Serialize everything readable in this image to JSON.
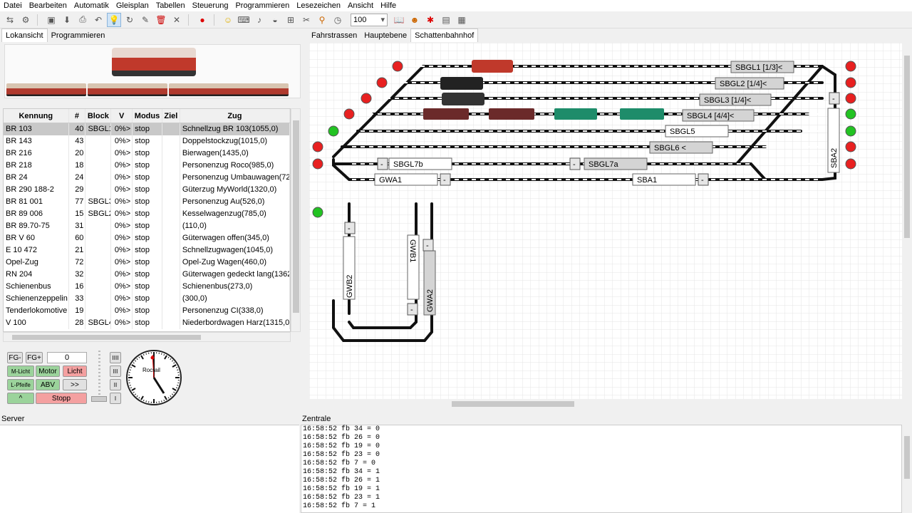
{
  "menu": [
    "Datei",
    "Bearbeiten",
    "Automatik",
    "Gleisplan",
    "Tabellen",
    "Steuerung",
    "Programmieren",
    "Lesezeichen",
    "Ansicht",
    "Hilfe"
  ],
  "toolbar": {
    "zoom": "100"
  },
  "left_tabs": [
    "Lokansicht",
    "Programmieren"
  ],
  "right_tabs": [
    "Fahrstrassen",
    "Hauptebene",
    "Schattenbahnhof"
  ],
  "table": {
    "headers": [
      "Kennung",
      "#",
      "Block",
      "V",
      "Modus",
      "Ziel",
      "Zug"
    ],
    "rows": [
      [
        "BR 103",
        "40",
        "SBGL1",
        "0%>",
        "stop",
        "",
        "Schnellzug BR 103(1055,0)"
      ],
      [
        "BR 143",
        "43",
        "",
        "0%>",
        "stop",
        "",
        "Doppelstockzug(1015,0)"
      ],
      [
        "BR 216",
        "20",
        "",
        "0%>",
        "stop",
        "",
        "Bierwagen(1435,0)"
      ],
      [
        "BR 218",
        "18",
        "",
        "0%>",
        "stop",
        "",
        "Personenzug Roco(985,0)"
      ],
      [
        "BR 24",
        "24",
        "",
        "0%>",
        "stop",
        "",
        "Personenzug Umbauwagen(725,0"
      ],
      [
        "BR 290 188-2",
        "29",
        "",
        "0%>",
        "stop",
        "",
        "Güterzug MyWorld(1320,0)"
      ],
      [
        "BR 81 001",
        "77",
        "SBGL3",
        "0%>",
        "stop",
        "",
        "Personenzug Au(526,0)"
      ],
      [
        "BR 89 006",
        "15",
        "SBGL2",
        "0%>",
        "stop",
        "",
        "Kesselwagenzug(785,0)"
      ],
      [
        "BR 89.70-75",
        "31",
        "",
        "0%>",
        "stop",
        "",
        "(110,0)"
      ],
      [
        "BR V 60",
        "60",
        "",
        "0%>",
        "stop",
        "",
        "Güterwagen offen(345,0)"
      ],
      [
        "E 10 472",
        "21",
        "",
        "0%>",
        "stop",
        "",
        "Schnellzugwagen(1045,0)"
      ],
      [
        "Opel-Zug",
        "72",
        "",
        "0%>",
        "stop",
        "",
        "Opel-Zug Wagen(460,0)"
      ],
      [
        "RN 204",
        "32",
        "",
        "0%>",
        "stop",
        "",
        "Güterwagen gedeckt lang(1362,0"
      ],
      [
        "Schienenbus",
        "16",
        "",
        "0%>",
        "stop",
        "",
        "Schienenbus(273,0)"
      ],
      [
        "Schienenzeppelin",
        "33",
        "",
        "0%>",
        "stop",
        "",
        "(300,0)"
      ],
      [
        "Tenderlokomotive",
        "19",
        "",
        "0%>",
        "stop",
        "",
        "Personenzug CI(338,0)"
      ],
      [
        "V 100",
        "28",
        "SBGL4",
        "0%>",
        "stop",
        "",
        "Niederbordwagen Harz(1315,0)"
      ]
    ]
  },
  "controls": {
    "fg_minus": "FG-",
    "fg_plus": "FG+",
    "speed": "0",
    "m_licht": "M-Licht",
    "motor": "Motor",
    "licht": "Licht",
    "l_pfeife": "L-Pfeife",
    "abv": "ABV",
    "fwd": ">>",
    "up": "^",
    "stopp": "Stopp",
    "dir_btns": [
      "IIII",
      "III",
      "II",
      "I"
    ],
    "clock_label": "Rocrail"
  },
  "blocks": {
    "sbgl1": "SBGL1 [1/3]<",
    "sbgl2": "SBGL2 [1/4]<",
    "sbgl3": "SBGL3 [1/4]<",
    "sbgl4": "SBGL4 [4/4]<",
    "sbgl5": "SBGL5",
    "sbgl6": "SBGL6 <",
    "sbgl7b": "SBGL7b",
    "sbgl7a": "SBGL7a",
    "gwa1": "GWA1",
    "sba1": "SBA1",
    "sba2": "SBA2",
    "gwb2": "GWB2",
    "gwb1": "GWB1",
    "gwa2": "GWA2",
    "dash": "-"
  },
  "bottom": {
    "server": "Server",
    "zentrale": "Zentrale"
  },
  "log": [
    "16:58:52 fb 34 = 0",
    "16:58:52 fb 26 = 0",
    "16:58:52 fb 19 = 0",
    "16:58:52 fb 23 = 0",
    "16:58:52 fb 7 = 0",
    "16:58:52 fb 34 = 1",
    "16:58:52 fb 26 = 1",
    "16:58:52 fb 19 = 1",
    "16:58:52 fb 23 = 1",
    "16:58:52 fb 7 = 1"
  ],
  "colors": {
    "signal_red": "#e82020",
    "signal_green": "#22c322",
    "block_fill": "#d4d4d4",
    "track": "#111111"
  }
}
